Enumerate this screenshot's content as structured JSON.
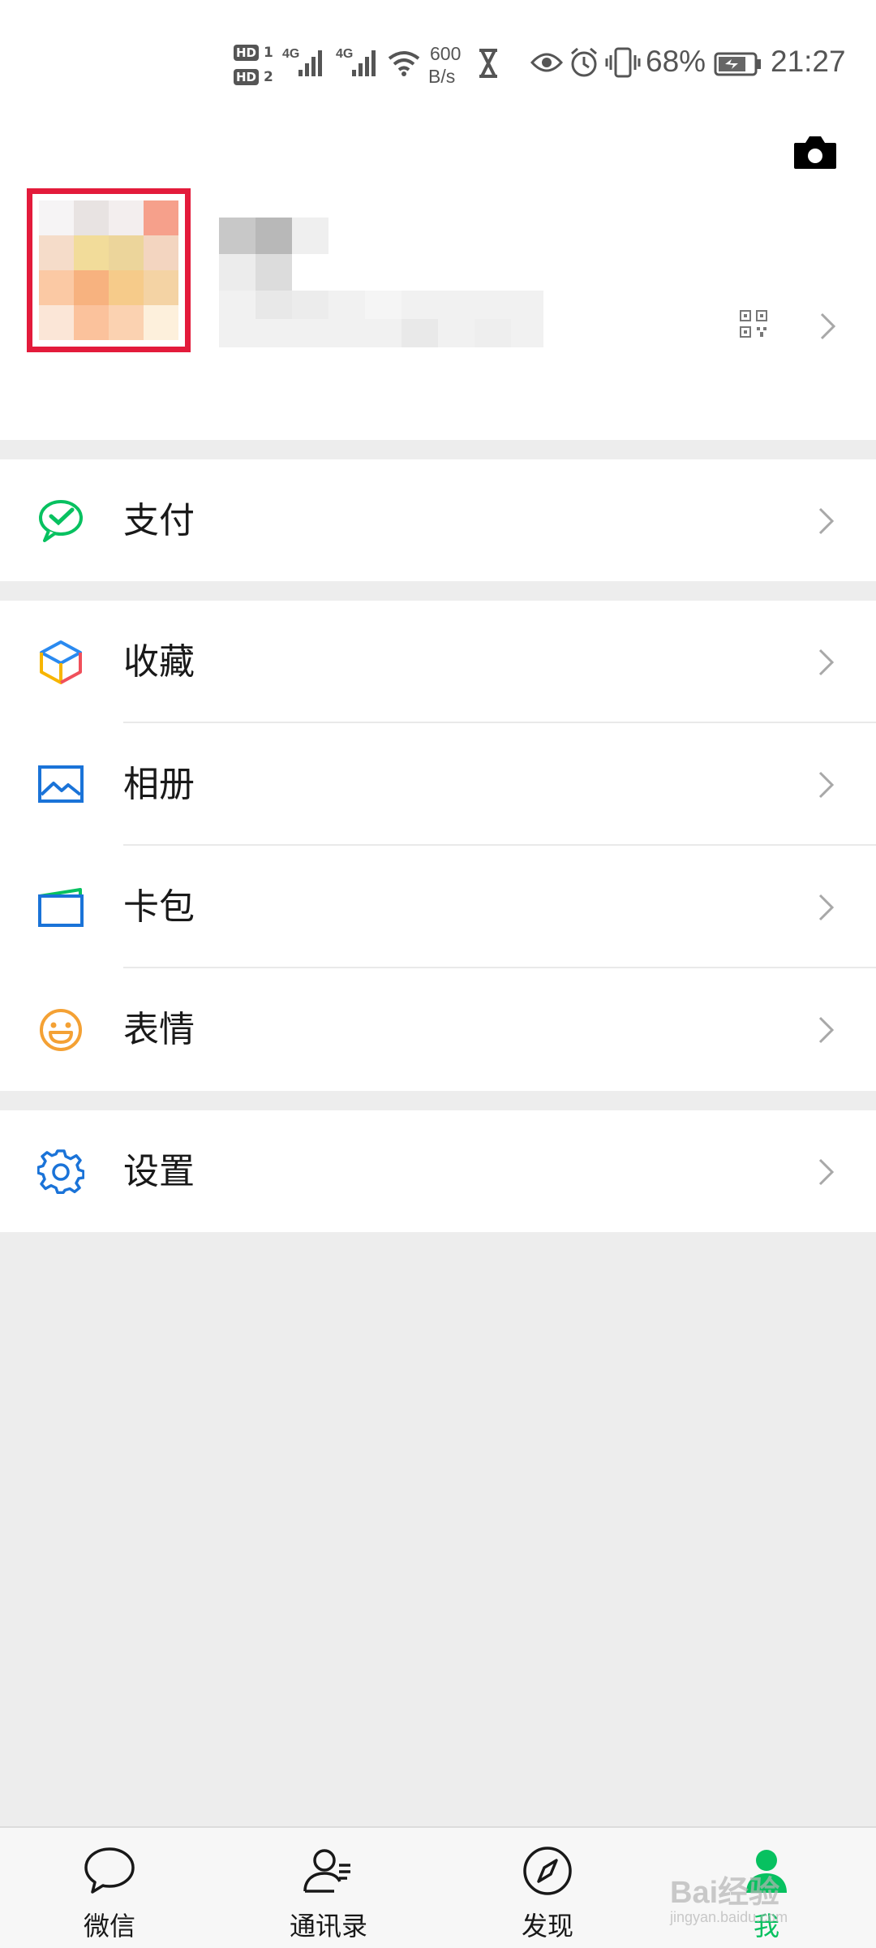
{
  "status_bar": {
    "hd1": "HD",
    "hd1_sub": "1",
    "hd2": "HD",
    "hd2_sub": "2",
    "net1": "4G",
    "net2": "4G",
    "speed_value": "600",
    "speed_unit": "B/s",
    "battery": "68%",
    "time": "21:27"
  },
  "profile": {
    "camera_icon": "camera-icon",
    "qr_icon": "qr-code-icon"
  },
  "menu": {
    "pay": {
      "label": "支付",
      "icon": "wechat-pay-icon",
      "color": "#07c160"
    },
    "favorites": {
      "label": "收藏",
      "icon": "cube-icon"
    },
    "album": {
      "label": "相册",
      "icon": "picture-icon",
      "color": "#1a73d8"
    },
    "cards": {
      "label": "卡包",
      "icon": "card-wallet-icon",
      "color": "#1a73d8"
    },
    "stickers": {
      "label": "表情",
      "icon": "smiley-icon",
      "color": "#f4a134"
    },
    "settings": {
      "label": "设置",
      "icon": "gear-icon",
      "color": "#1a73d8"
    }
  },
  "tabbar": {
    "chats": "微信",
    "contacts": "通讯录",
    "discover": "发现",
    "me": "我",
    "active_color": "#07c160"
  },
  "watermark": {
    "brand": "Bai经验",
    "url": "jingyan.baidu.com"
  }
}
